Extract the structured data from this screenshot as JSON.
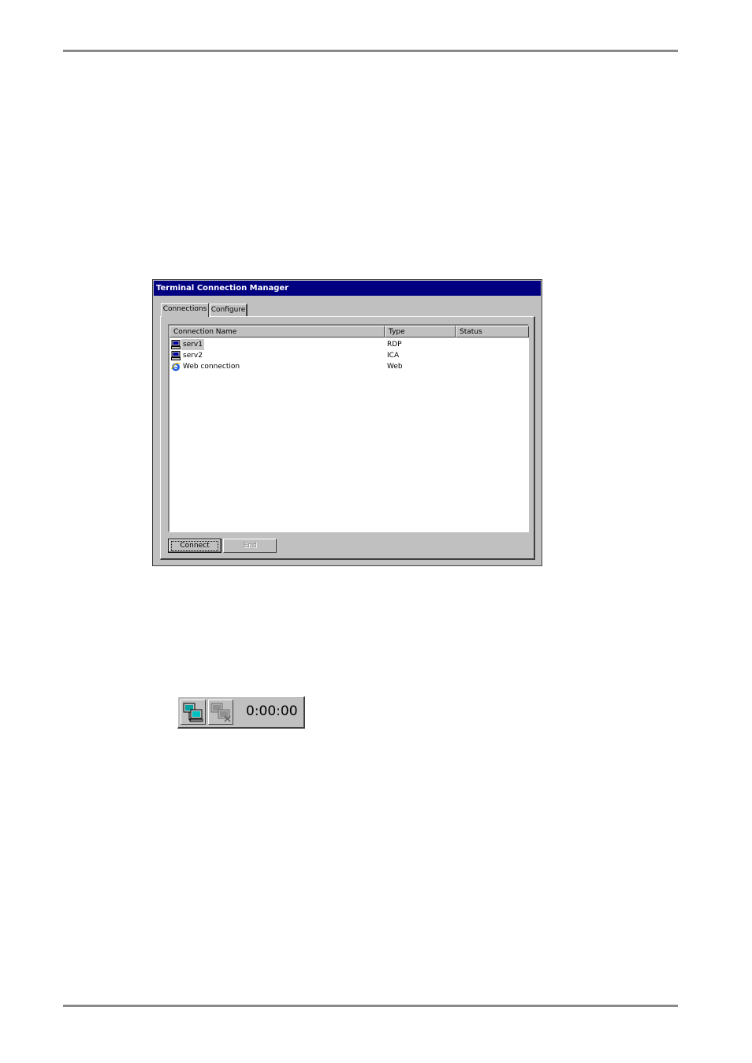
{
  "window": {
    "title": "Terminal Connection Manager",
    "tabs": [
      {
        "label": "Connections",
        "active": true
      },
      {
        "label": "Configure",
        "active": false
      }
    ],
    "list": {
      "columns": [
        "Connection Name",
        "Type",
        "Status"
      ],
      "rows": [
        {
          "name": "serv1",
          "type": "RDP",
          "status": "",
          "icon": "computer-icon",
          "selected": true
        },
        {
          "name": "serv2",
          "type": "ICA",
          "status": "",
          "icon": "computer-icon",
          "selected": false
        },
        {
          "name": "Web connection",
          "type": "Web",
          "status": "",
          "icon": "internet-explorer-icon",
          "selected": false
        }
      ]
    },
    "buttons": {
      "connect": "Connect",
      "end": "End"
    }
  },
  "toolbar": {
    "timer": "0:00:00",
    "connect_icon": "connect-network-icon",
    "disconnect_icon": "disconnect-network-icon"
  },
  "colors": {
    "titlebar": "#000080",
    "window_bg": "#c0c0c0",
    "rule": "#8a8a8a"
  }
}
